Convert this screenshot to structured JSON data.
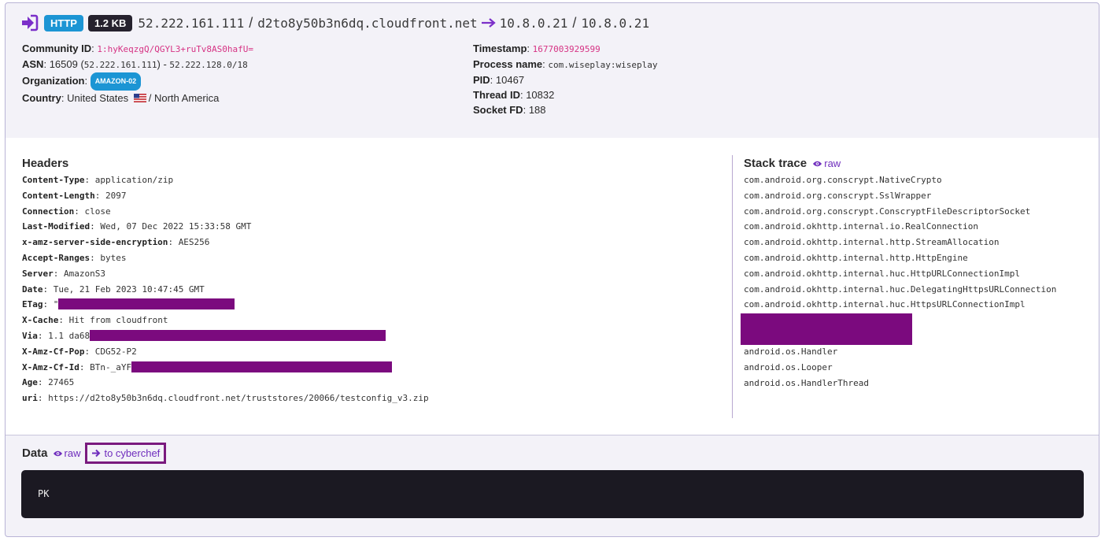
{
  "flow": {
    "protocol": "HTTP",
    "size": "1.2 KB",
    "src_ip": "52.222.161.111",
    "src_host": "d2to8y50b3n6dq.cloudfront.net",
    "dst_ip": "10.8.0.21",
    "dst_host": "10.8.0.21",
    "sep": "/"
  },
  "left_info": {
    "community_id_label": "Community ID",
    "community_id": "1:hyKeqzgQ/QGYL3+ruTv8AS0hafU=",
    "asn_label": "ASN",
    "asn": "16509",
    "asn_ip": "52.222.161.111",
    "asn_range": "52.222.128.0/18",
    "org_label": "Organization",
    "org": "AMAZON-02",
    "country_label": "Country",
    "country": "United States",
    "continent": "North America"
  },
  "right_info": {
    "timestamp_label": "Timestamp",
    "timestamp": "1677003929599",
    "process_label": "Process name",
    "process": "com.wiseplay:wiseplay",
    "pid_label": "PID",
    "pid": "10467",
    "thread_label": "Thread ID",
    "thread": "10832",
    "socket_label": "Socket FD",
    "socket": "188"
  },
  "headers": {
    "title": "Headers",
    "items": [
      {
        "key": "Content-Type",
        "value": "application/zip"
      },
      {
        "key": "Content-Length",
        "value": "2097"
      },
      {
        "key": "Connection",
        "value": "close"
      },
      {
        "key": "Last-Modified",
        "value": "Wed, 07 Dec 2022 15:33:58 GMT"
      },
      {
        "key": "x-amz-server-side-encryption",
        "value": "AES256"
      },
      {
        "key": "Accept-Ranges",
        "value": "bytes"
      },
      {
        "key": "Server",
        "value": "AmazonS3"
      },
      {
        "key": "Date",
        "value": "Tue, 21 Feb 2023 10:47:45 GMT"
      },
      {
        "key": "ETag",
        "value": "\""
      },
      {
        "key": "X-Cache",
        "value": "Hit from cloudfront"
      },
      {
        "key": "Via",
        "value": "1.1 da68"
      },
      {
        "key": "X-Amz-Cf-Pop",
        "value": "CDG52-P2"
      },
      {
        "key": "X-Amz-Cf-Id",
        "value": "BTn-_aYF"
      },
      {
        "key": "Age",
        "value": "27465"
      },
      {
        "key": "uri",
        "value": "https://d2to8y50b3n6dq.cloudfront.net/truststores/20066/testconfig_v3.zip"
      }
    ]
  },
  "stack": {
    "title": "Stack trace",
    "raw_label": "raw",
    "frames_top": [
      "com.android.org.conscrypt.NativeCrypto",
      "com.android.org.conscrypt.SslWrapper",
      "com.android.org.conscrypt.ConscryptFileDescriptorSocket",
      "com.android.okhttp.internal.io.RealConnection",
      "com.android.okhttp.internal.http.StreamAllocation",
      "com.android.okhttp.internal.http.HttpEngine",
      "com.android.okhttp.internal.huc.HttpURLConnectionImpl",
      "com.android.okhttp.internal.huc.DelegatingHttpsURLConnection",
      "com.android.okhttp.internal.huc.HttpsURLConnectionImpl"
    ],
    "frames_bottom": [
      "android.os.Handler",
      "android.os.Looper",
      "android.os.HandlerThread"
    ]
  },
  "data": {
    "title": "Data",
    "raw_label": "raw",
    "cyberchef_label": "to cyberchef",
    "content": "PK"
  },
  "colors": {
    "accent": "#6f2dbd",
    "redaction": "#7b0a7e",
    "http_badge": "#1c95d4"
  }
}
